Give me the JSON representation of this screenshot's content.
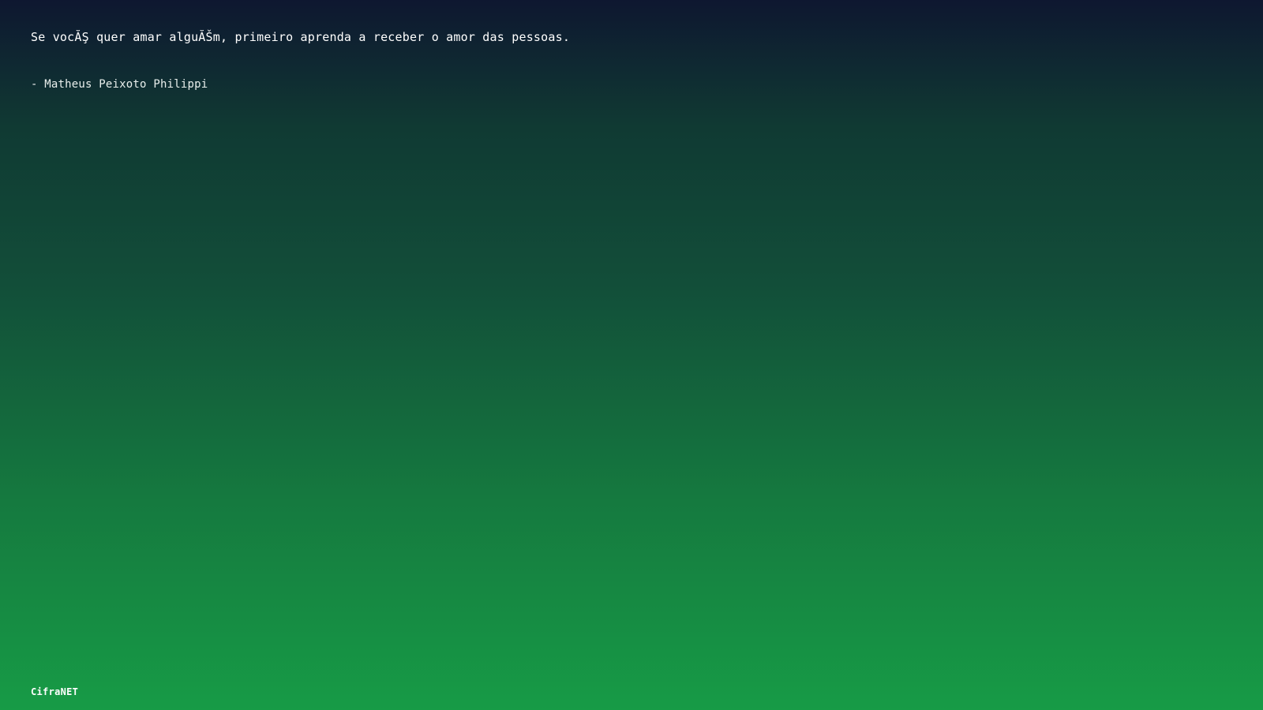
{
  "quote": {
    "text": "Se vocĂŞ quer amar alguĂŠm, primeiro aprenda a receber o amor das pessoas.",
    "author": "- Matheus Peixoto Philippi"
  },
  "footer": {
    "brand": "CifraNET"
  },
  "colors": {
    "gradient_top": "#0e1730",
    "gradient_bottom": "#179b46",
    "text": "#ffffff"
  }
}
